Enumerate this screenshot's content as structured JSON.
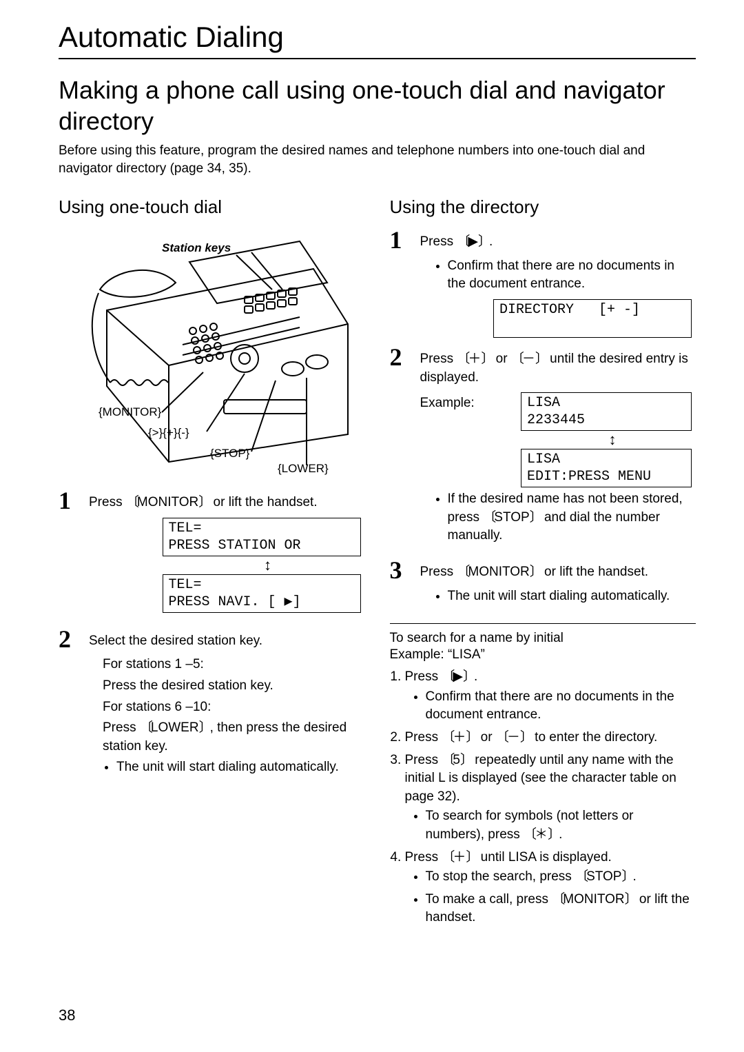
{
  "pageNumber": "38",
  "chapter": "Automatic Dialing",
  "title": "Making a phone call using one-touch dial and navigator directory",
  "intro": "Before using this feature, program the desired names and telephone numbers into one-touch dial and navigator directory (page 34, 35).",
  "left": {
    "heading": "Using one-touch dial",
    "labels": {
      "station": "Station keys",
      "monitor": "{MONITOR}",
      "nav": "{>}{+}{-}",
      "stop": "{STOP}",
      "lower": "{LOWER}"
    },
    "step1": {
      "num": "1",
      "before": "Press ",
      "key": "MONITOR",
      "after": " or lift the handset."
    },
    "lcd1a": "TEL=\nPRESS STATION OR",
    "lcd1b": "TEL=\nPRESS NAVI. [ ▶]",
    "step2": {
      "num": "2",
      "text": "Select the desired station key.",
      "s15_label": "For stations 1 –5:",
      "s15_text": "Press the desired station key.",
      "s610_label": "For stations 6 –10:",
      "s610_before": "Press ",
      "s610_key": "LOWER",
      "s610_after": ", then press the desired station key.",
      "bullet": "The unit will start dialing automatically."
    }
  },
  "right": {
    "heading": "Using the directory",
    "step1": {
      "num": "1",
      "before": "Press ",
      "key": "▶",
      "after": ".",
      "bullet": "Confirm that there are no documents in the document entrance."
    },
    "lcd1": "DIRECTORY   [+ -]\n ",
    "step2": {
      "num": "2",
      "before": "Press ",
      "keyA": "＋",
      "mid": " or ",
      "keyB": "－",
      "after": " until the desired entry is displayed.",
      "exampleLabel": "Example:",
      "lcdA": "LISA\n2233445",
      "lcdB": "LISA\nEDIT:PRESS MENU",
      "bul_before": "If the desired name has not been stored, press ",
      "bul_key": "STOP",
      "bul_after": " and dial the number manually."
    },
    "step3": {
      "num": "3",
      "before": "Press ",
      "key": "MONITOR",
      "after": " or lift the handset.",
      "bullet": "The unit will start dialing automatically."
    },
    "search": {
      "head1": "To search for a name by initial",
      "head2": "Example:  “LISA”",
      "i1_before": "Press ",
      "i1_key": "▶",
      "i1_after": ".",
      "i1_bullet": "Confirm that there are no documents in the document entrance.",
      "i2_before": "Press ",
      "i2_keyA": "＋",
      "i2_mid": " or ",
      "i2_keyB": "－",
      "i2_after": " to enter the directory.",
      "i3_before": "Press ",
      "i3_key": "5",
      "i3_after": " repeatedly until any name with the initial  L  is displayed (see the character table on page 32).",
      "i3_bullet_before": "To search for symbols (not letters or numbers), press ",
      "i3_bullet_key": "＊",
      "i3_bullet_after": ".",
      "i4_before": "Press ",
      "i4_key": "＋",
      "i4_after": " until  LISA  is displayed.",
      "i4_b1_before": "To stop the search, press ",
      "i4_b1_key": "STOP",
      "i4_b1_after": ".",
      "i4_b2_before": "To make a call, press ",
      "i4_b2_key": "MONITOR",
      "i4_b2_after": " or lift the handset."
    }
  }
}
